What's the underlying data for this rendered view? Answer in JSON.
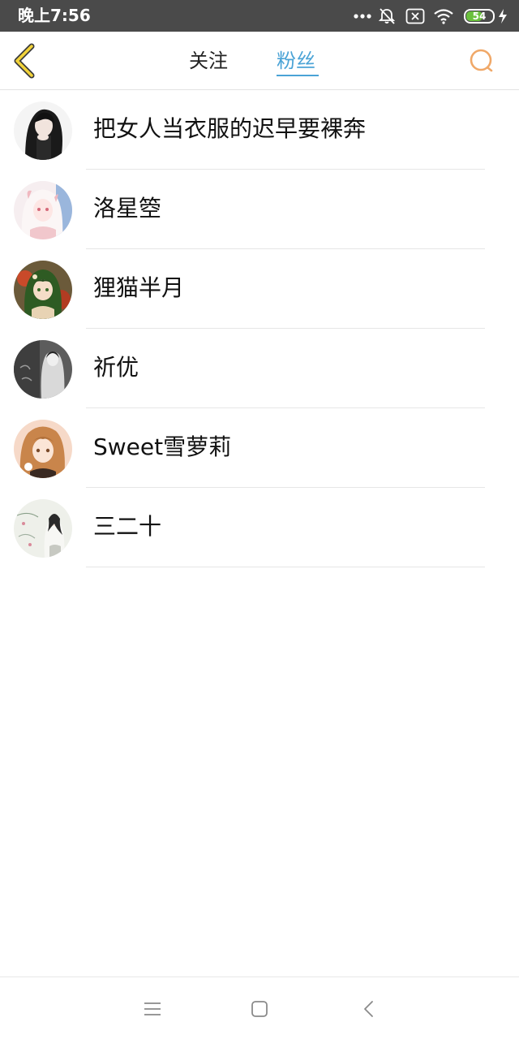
{
  "status_bar": {
    "time": "晚上7:56",
    "battery_level": "54",
    "icons": [
      "more-dots-icon",
      "bell-off-icon",
      "no-sim-icon",
      "wifi-icon",
      "battery-icon",
      "charging-icon"
    ]
  },
  "header": {
    "back_icon": "chevron-left-icon",
    "tabs": [
      {
        "label": "关注",
        "active": false
      },
      {
        "label": "粉丝",
        "active": true
      }
    ],
    "search_icon": "search-icon"
  },
  "fans": [
    {
      "name": "把女人当衣服的迟早要裸奔"
    },
    {
      "name": "洛星箜"
    },
    {
      "name": "狸猫半月"
    },
    {
      "name": "祈优"
    },
    {
      "name": "Sweet雪萝莉"
    },
    {
      "name": "三二十"
    }
  ],
  "nav_bar": {
    "buttons": [
      "menu-icon",
      "home-icon",
      "back-icon"
    ]
  },
  "colors": {
    "accent": "#4aa3d6",
    "back_icon": "#f2c61f",
    "search_icon": "#f0a868",
    "status_bar_bg": "#4a4a4a",
    "battery": "#6ac13d"
  }
}
